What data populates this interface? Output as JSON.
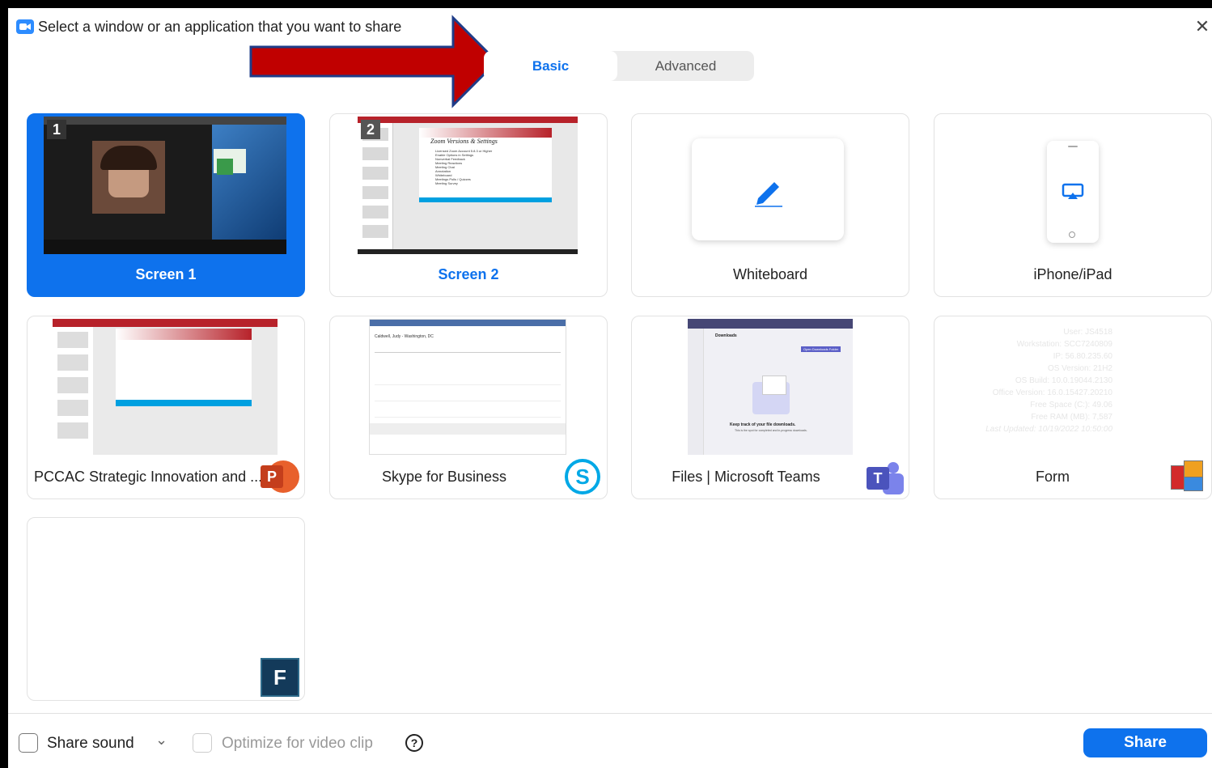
{
  "window": {
    "title": "Select a window or an application that you want to share",
    "close_glyph": "✕"
  },
  "tabs": [
    {
      "label": "Basic",
      "selected": true
    },
    {
      "label": "Advanced",
      "selected": false
    }
  ],
  "tiles": [
    {
      "label": "Screen 1",
      "number": "1",
      "selected": true
    },
    {
      "label": "Screen 2",
      "number": "2",
      "selected": false
    },
    {
      "label": "Whiteboard",
      "icon": "pen-icon"
    },
    {
      "label": "iPhone/iPad",
      "icon": "airplay-device-icon"
    },
    {
      "label": "PCCAC Strategic Innovation and ...",
      "icon": "powerpoint-icon",
      "icon_letter": "P"
    },
    {
      "label": "Skype for Business",
      "icon": "skype-icon",
      "icon_letter": "S"
    },
    {
      "label": "Files | Microsoft Teams",
      "icon": "teams-icon",
      "icon_letter": "T"
    },
    {
      "label": "Form",
      "icon": "form-app-icon"
    },
    {
      "label": "",
      "icon": "f-app-icon",
      "icon_letter": "F"
    }
  ],
  "thumbnails": {
    "screen2_slide_title": "Zoom Versions & Settings",
    "screen2_bullets": [
      "Licensed Zoom Account 5.8.3 or Higher",
      "Enable Options in Settings",
      "Nonverbal Feedback",
      "Meeting Reactions",
      "Meeting Chat",
      "Annotation",
      "Whiteboard",
      "Meetings Polls / Quizzes",
      "Meeting Survey"
    ],
    "teams_heading": "Downloads",
    "teams_button": "Open Downloads Folder",
    "teams_caption": "Keep track of your file downloads.",
    "teams_subcaption": "This is the spot for completed and in-progress downloads.",
    "skype_user": "Caldwell, Judy - Washington, DC",
    "form_lines": [
      "User: JS4518",
      "Workstation: SCC7240809",
      "IP: 56.80.235.60",
      "OS Version: 21H2",
      "OS Build: 10.0.19044.2130",
      "Office Version: 16.0.15427.20210",
      "Free Space (C:): 49.06",
      "Free RAM (MB): 7,587",
      "Last Updated: 10/19/2022 10:50:00"
    ]
  },
  "bottom": {
    "share_sound_label": "Share sound",
    "share_sound_checked": false,
    "optimize_label": "Optimize for video clip",
    "optimize_enabled": false,
    "help_glyph": "?",
    "dropdown_glyph": "⌄",
    "share_button": "Share"
  },
  "colors": {
    "accent": "#0e72ed",
    "arrow": "#c00000"
  }
}
